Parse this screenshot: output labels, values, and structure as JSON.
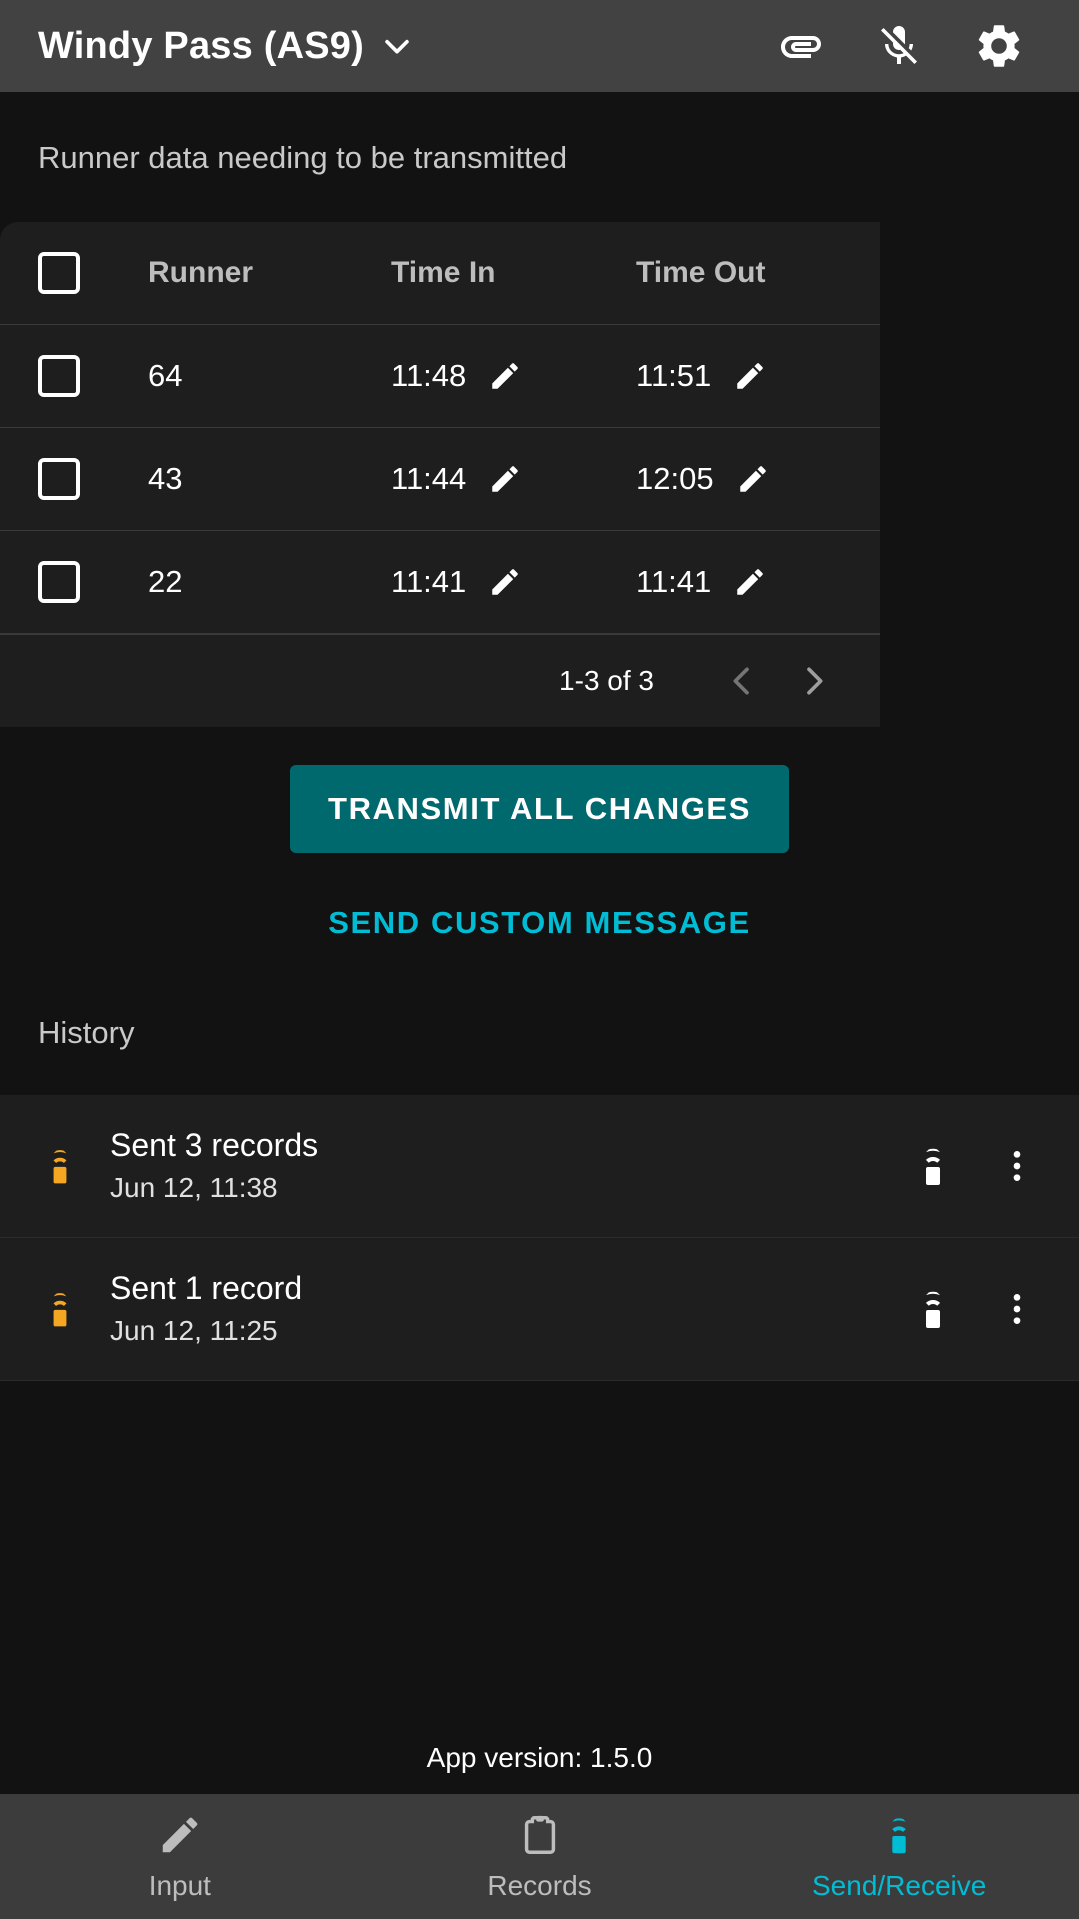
{
  "appbar": {
    "title": "Windy Pass (AS9)",
    "dropdown_icon": "chevron-down-icon",
    "attach_icon": "paperclip-icon",
    "mic_off_icon": "microphone-off-icon",
    "settings_icon": "gear-icon"
  },
  "main": {
    "section_label": "Runner data needing to be transmitted",
    "table": {
      "columns": [
        "",
        "Runner",
        "Time In",
        "Time Out"
      ],
      "headers": {
        "runner": "Runner",
        "time_in": "Time In",
        "time_out": "Time Out"
      },
      "rows": [
        {
          "runner": "64",
          "time_in": "11:48",
          "time_out": "11:51",
          "selected": false
        },
        {
          "runner": "43",
          "time_in": "11:44",
          "time_out": "12:05",
          "selected": false
        },
        {
          "runner": "22",
          "time_in": "11:41",
          "time_out": "11:41",
          "selected": false
        }
      ],
      "edit_icon": "pencil-icon",
      "select_all_checkbox": false
    },
    "pagination": {
      "range": "1-3 of 3",
      "prev_icon": "chevron-left-icon",
      "next_icon": "chevron-right-icon"
    },
    "actions": {
      "transmit_label": "TRANSMIT ALL CHANGES",
      "custom_message_label": "SEND CUSTOM MESSAGE"
    },
    "history": {
      "label": "History",
      "items": [
        {
          "title": "Sent 3 records",
          "timestamp": "Jun 12, 11:38",
          "lead_icon": "remote-transmit-icon",
          "trail_icon": "remote-transmit-icon",
          "menu_icon": "more-vertical-icon"
        },
        {
          "title": "Sent 1 record",
          "timestamp": "Jun 12, 11:25",
          "lead_icon": "remote-transmit-icon",
          "trail_icon": "remote-transmit-icon",
          "menu_icon": "more-vertical-icon"
        }
      ]
    },
    "app_version": "App version: 1.5.0"
  },
  "bottom_nav": {
    "items": [
      {
        "label": "Input",
        "icon": "pencil-icon",
        "active": false
      },
      {
        "label": "Records",
        "icon": "clipboard-icon",
        "active": false
      },
      {
        "label": "Send/Receive",
        "icon": "remote-transmit-icon",
        "active": true
      }
    ]
  },
  "colors": {
    "accent": "#00bcd4",
    "primary_button": "#00696e",
    "appbar": "#424242",
    "background": "#121212",
    "surface": "#1e1e1e",
    "history_lead_icon": "#f5a623"
  }
}
